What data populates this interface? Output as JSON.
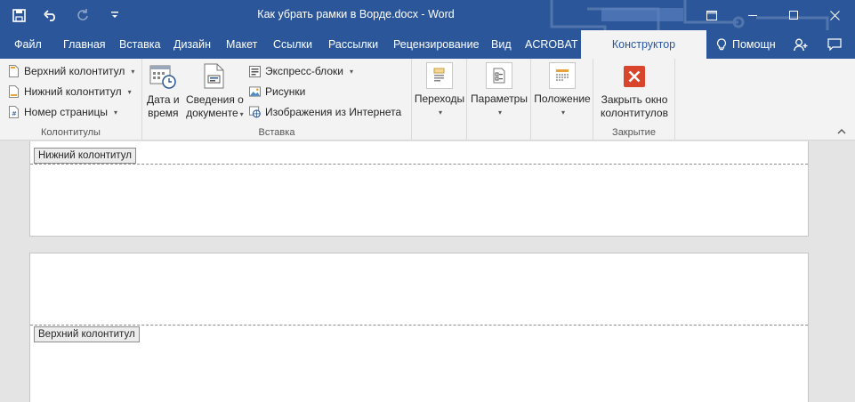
{
  "window": {
    "title": "Как убрать рамки в Ворде.docx - Word"
  },
  "tabs": {
    "file": "Файл",
    "home": "Главная",
    "insert": "Вставка",
    "design": "Дизайн",
    "layout": "Макет",
    "references": "Ссылки",
    "mailings": "Рассылки",
    "review": "Рецензирование",
    "view": "Вид",
    "acrobat": "ACROBAT",
    "constructor": "Конструктор",
    "tell_me": "Помощн"
  },
  "ribbon": {
    "headers_footers": {
      "label": "Колонтитулы",
      "header": "Верхний колонтитул",
      "footer": "Нижний колонтитул",
      "page_number": "Номер страницы"
    },
    "insert": {
      "label": "Вставка",
      "date_time_1": "Дата и",
      "date_time_2": "время",
      "doc_info_1": "Сведения о",
      "doc_info_2": "документе",
      "quick_parts": "Экспресс-блоки",
      "pictures": "Рисунки",
      "online_pictures": "Изображения из Интернета"
    },
    "navigation": {
      "label": "Переходы"
    },
    "options": {
      "label": "Параметры"
    },
    "position": {
      "label": "Положение"
    },
    "close": {
      "label": "Закрытие",
      "button_1": "Закрыть окно",
      "button_2": "колонтитулов"
    }
  },
  "document": {
    "footer_tag": "Нижний колонтитул",
    "header_tag": "Верхний колонтитул"
  },
  "colors": {
    "word_blue": "#2b579a",
    "ribbon_bg": "#f3f3f3",
    "close_red": "#d9452c"
  }
}
